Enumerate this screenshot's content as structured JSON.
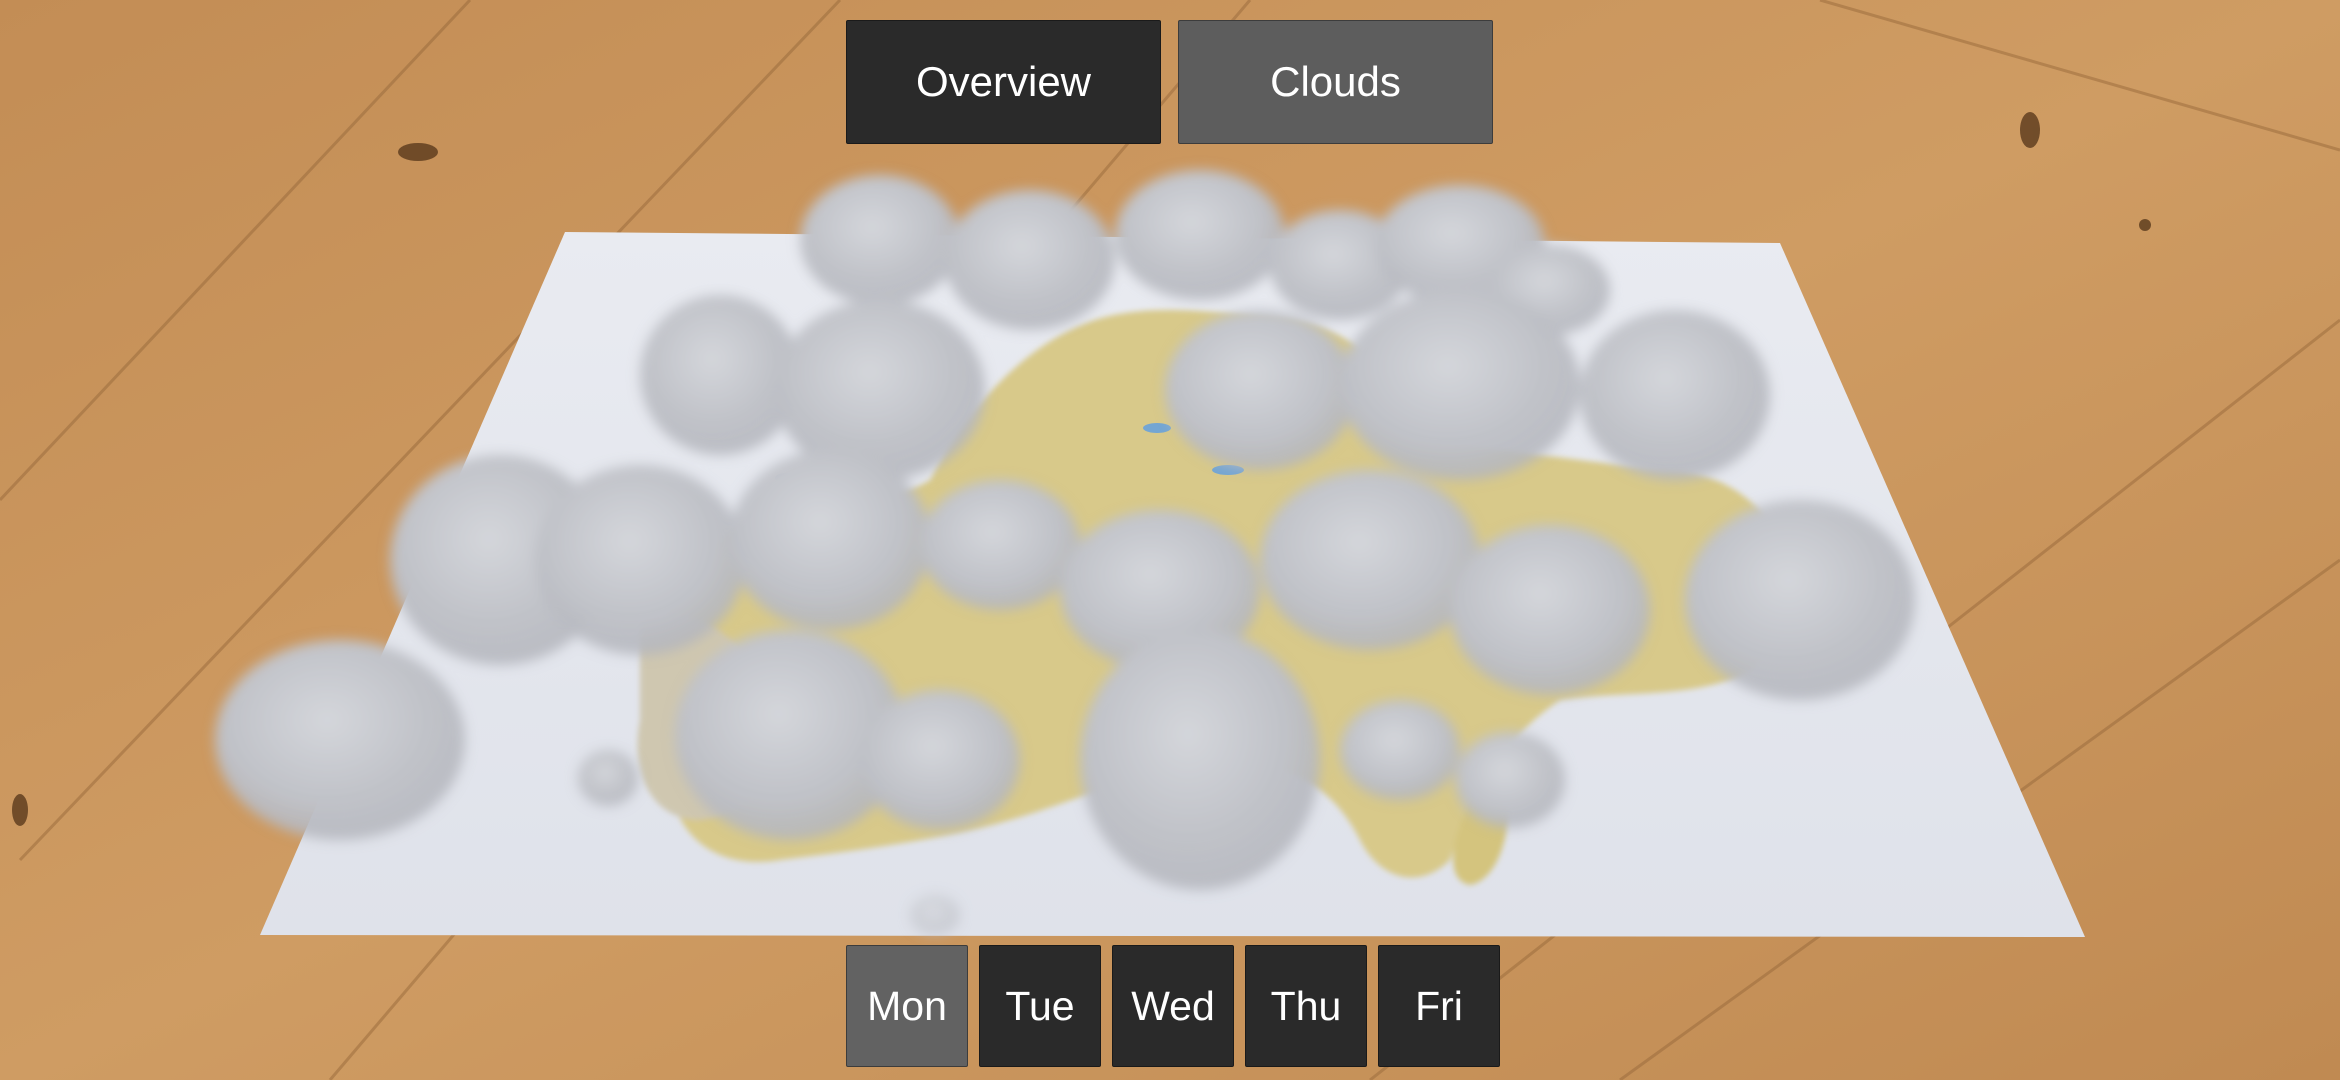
{
  "view_tabs": [
    {
      "label": "Overview",
      "selected": false
    },
    {
      "label": "Clouds",
      "selected": true
    }
  ],
  "days": [
    {
      "label": "Mon",
      "selected": true
    },
    {
      "label": "Tue",
      "selected": false
    },
    {
      "label": "Wed",
      "selected": false
    },
    {
      "label": "Thu",
      "selected": false
    },
    {
      "label": "Fri",
      "selected": false
    }
  ],
  "colors": {
    "button_dark": "#2a2a2a",
    "button_selected": "#5d5d5d",
    "button_text": "#ffffff",
    "table_wood": "#c9955a",
    "paper": "#eceef4",
    "cloud": "#c2c4ca",
    "terrain": "#d8c98a"
  }
}
